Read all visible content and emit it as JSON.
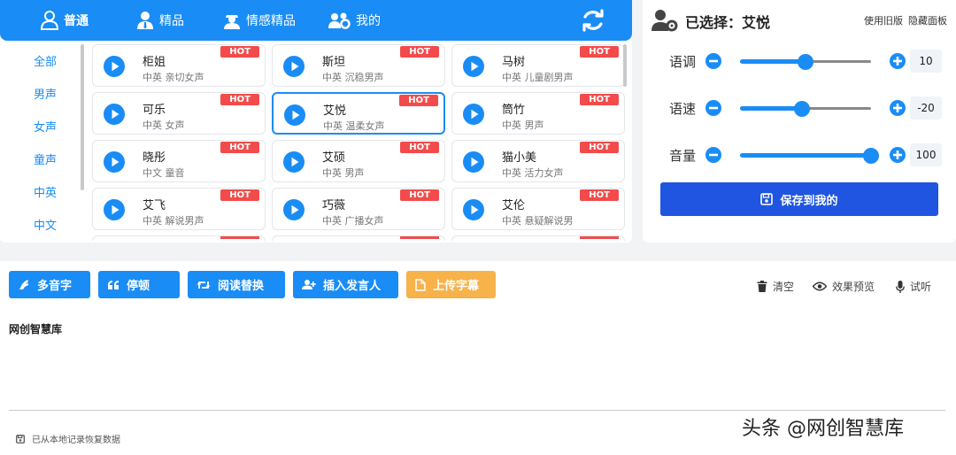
{
  "nav": {
    "tabs": [
      {
        "label": "普通",
        "active": true
      },
      {
        "label": "精品",
        "active": false
      },
      {
        "label": "情感精品",
        "active": false
      },
      {
        "label": "我的",
        "active": false
      }
    ]
  },
  "categories": [
    "全部",
    "男声",
    "女声",
    "童声",
    "中英",
    "中文"
  ],
  "voices": [
    {
      "name": "柜姐",
      "desc": "中英 亲切女声",
      "badge": "HOT"
    },
    {
      "name": "斯坦",
      "desc": "中英 沉稳男声",
      "badge": "HOT"
    },
    {
      "name": "马树",
      "desc": "中英 儿童剧男声",
      "badge": "HOT"
    },
    {
      "name": "可乐",
      "desc": "中英 女声",
      "badge": "HOT"
    },
    {
      "name": "艾悦",
      "desc": "中英 温柔女声",
      "badge": "HOT",
      "selected": true
    },
    {
      "name": "筒竹",
      "desc": "中英 男声",
      "badge": "HOT"
    },
    {
      "name": "晓彤",
      "desc": "中文 童音",
      "badge": "HOT"
    },
    {
      "name": "艾硕",
      "desc": "中英 男声",
      "badge": "HOT"
    },
    {
      "name": "猫小美",
      "desc": "中英 活力女声",
      "badge": "HOT"
    },
    {
      "name": "艾飞",
      "desc": "中英 解说男声",
      "badge": "HOT"
    },
    {
      "name": "巧薇",
      "desc": "中英 广播女声",
      "badge": "HOT"
    },
    {
      "name": "艾伦",
      "desc": "中英 悬疑解说男",
      "badge": "HOT"
    }
  ],
  "settings": {
    "selected_title": "已选择：艾悦",
    "old_version": "使用旧版",
    "hide_panel": "隐藏面板",
    "sliders": [
      {
        "label": "语调",
        "value": "10",
        "fraction": 0.5
      },
      {
        "label": "语速",
        "value": "-20",
        "fraction": 0.47
      },
      {
        "label": "音量",
        "value": "100",
        "fraction": 1.0
      }
    ],
    "save_label": "保存到我的"
  },
  "toolbar": {
    "buttons": [
      {
        "label": "多音字",
        "icon": "hand-icon"
      },
      {
        "label": "停顿",
        "icon": "quote-icon"
      },
      {
        "label": "阅读替换",
        "icon": "retweet-icon"
      },
      {
        "label": "插入发言人",
        "icon": "user-plus-icon"
      },
      {
        "label": "上传字幕",
        "icon": "file-icon"
      }
    ],
    "right": [
      {
        "label": "清空",
        "icon": "trash-icon"
      },
      {
        "label": "效果预览",
        "icon": "eye-icon"
      },
      {
        "label": "试听",
        "icon": "mic-icon"
      }
    ]
  },
  "editor": {
    "text": "网创智慧库",
    "status": "已从本地记录恢复数据"
  },
  "watermark": "头条 @网创智慧库",
  "colors": {
    "primary": "#1a8cf5",
    "hot": "#f34b4b",
    "save": "#1f55e0",
    "upload": "#f7b24a"
  }
}
